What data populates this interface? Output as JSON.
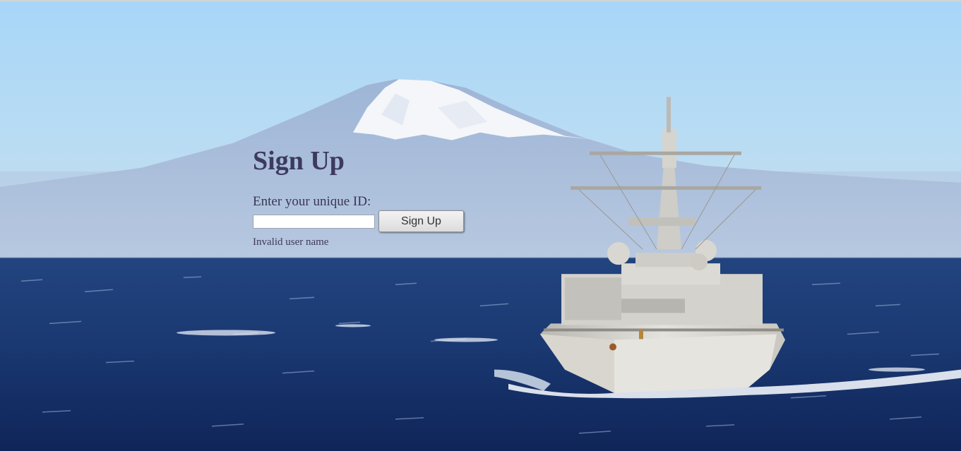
{
  "signup": {
    "title": "Sign Up",
    "id_label": "Enter your unique ID:",
    "id_value": "",
    "id_placeholder": "",
    "button_label": "Sign Up",
    "error_message": "Invalid user name"
  },
  "background": {
    "scene": "mountain-ship-ocean-image",
    "sky_color": "#a9d6f7",
    "sea_color": "#1b3a78"
  }
}
